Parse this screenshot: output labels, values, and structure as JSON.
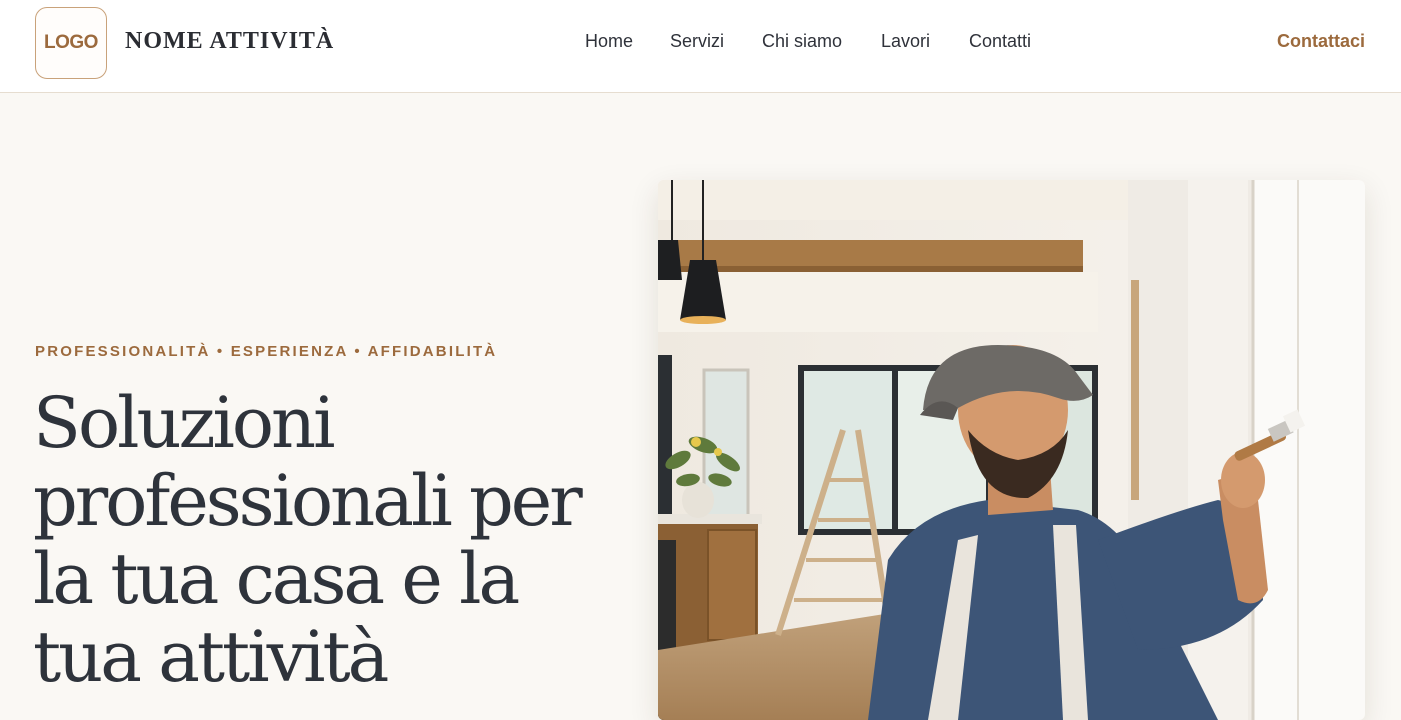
{
  "header": {
    "logo_text": "LOGO",
    "brand_name": "NOME ATTIVITÀ",
    "nav": [
      {
        "label": "Home"
      },
      {
        "label": "Servizi"
      },
      {
        "label": "Chi siamo"
      },
      {
        "label": "Lavori"
      },
      {
        "label": "Contatti"
      }
    ],
    "cta_label": "Contattaci"
  },
  "hero": {
    "tagline": "PROFESSIONALITÀ • ESPERIENZA • AFFIDABILITÀ",
    "headline": "Soluzioni professionali per la tua casa e la tua attività",
    "image_icon": "hero-photo-painter"
  },
  "colors": {
    "accent": "#9c6a3d",
    "page_bg": "#faf8f4",
    "text": "#2e333b",
    "header_border": "#e6ddd0"
  }
}
